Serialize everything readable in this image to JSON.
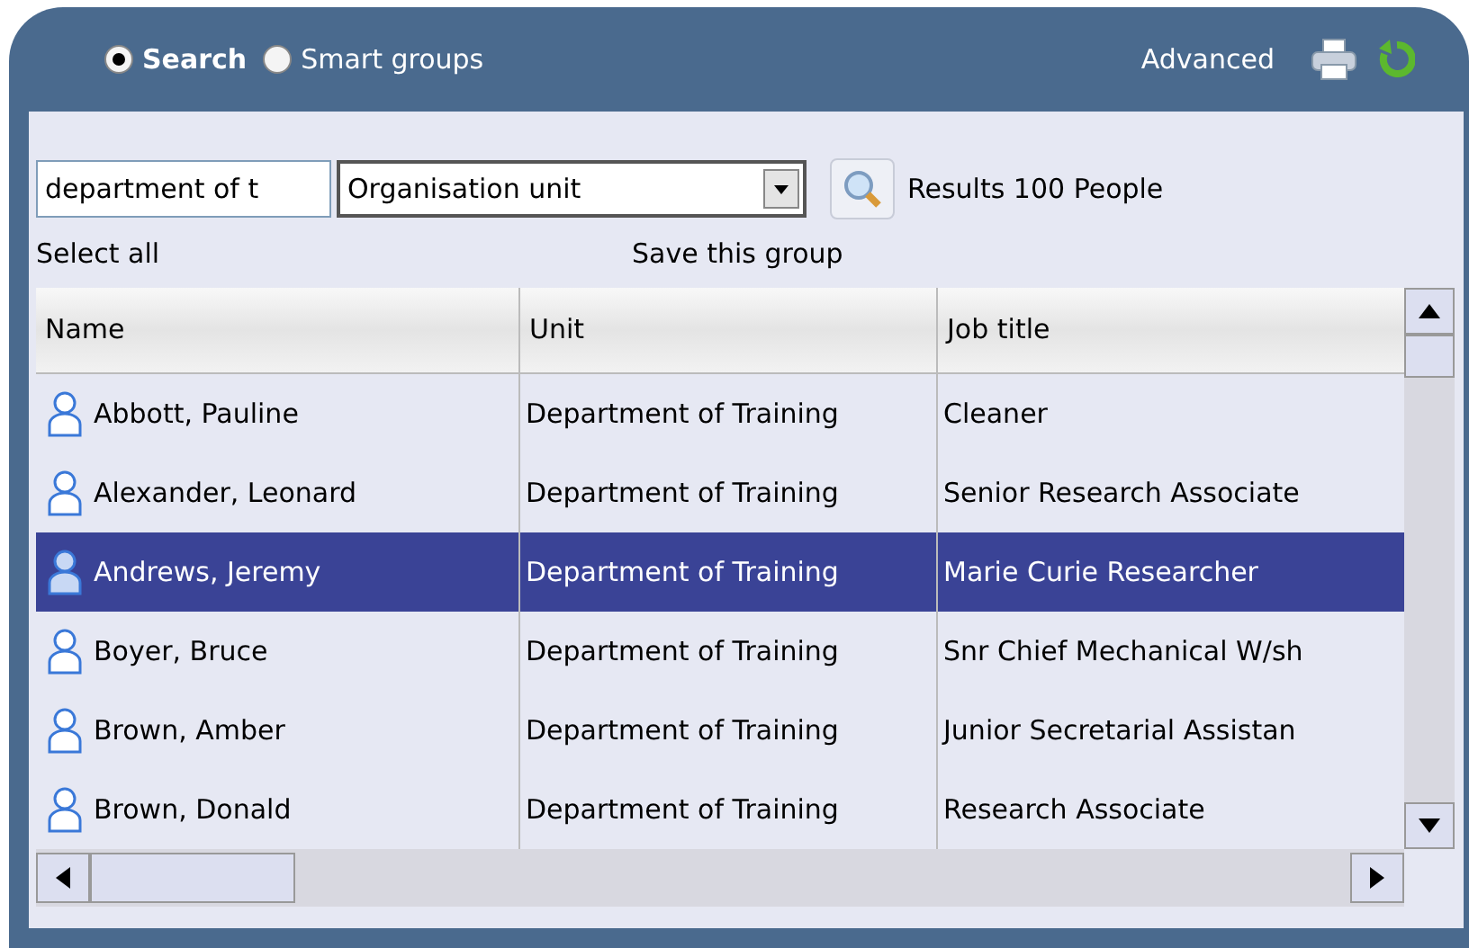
{
  "mode_options": [
    {
      "label": "Search",
      "selected": true
    },
    {
      "label": "Smart groups",
      "selected": false
    }
  ],
  "advanced_link": "Advanced",
  "search": {
    "value": "department of t",
    "field": "Organisation unit",
    "results": "Results 100 People"
  },
  "actions": {
    "select_all": "Select all",
    "save_group": "Save this group"
  },
  "table": {
    "columns": [
      "Name",
      "Unit",
      "Job title"
    ],
    "rows": [
      {
        "name": "Abbott, Pauline",
        "unit": "Department of Training",
        "job": "Cleaner",
        "selected": false
      },
      {
        "name": "Alexander, Leonard",
        "unit": "Department of Training",
        "job": "Senior Research Associate",
        "selected": false
      },
      {
        "name": "Andrews, Jeremy",
        "unit": "Department of Training",
        "job": "Marie Curie Researcher",
        "selected": true
      },
      {
        "name": "Boyer, Bruce",
        "unit": "Department of Training",
        "job": "Snr Chief Mechanical W/sh",
        "selected": false
      },
      {
        "name": "Brown, Amber",
        "unit": "Department of Training",
        "job": "Junior Secretarial Assistan",
        "selected": false
      },
      {
        "name": "Brown, Donald",
        "unit": "Department of Training",
        "job": "Research Associate",
        "selected": false
      }
    ]
  }
}
